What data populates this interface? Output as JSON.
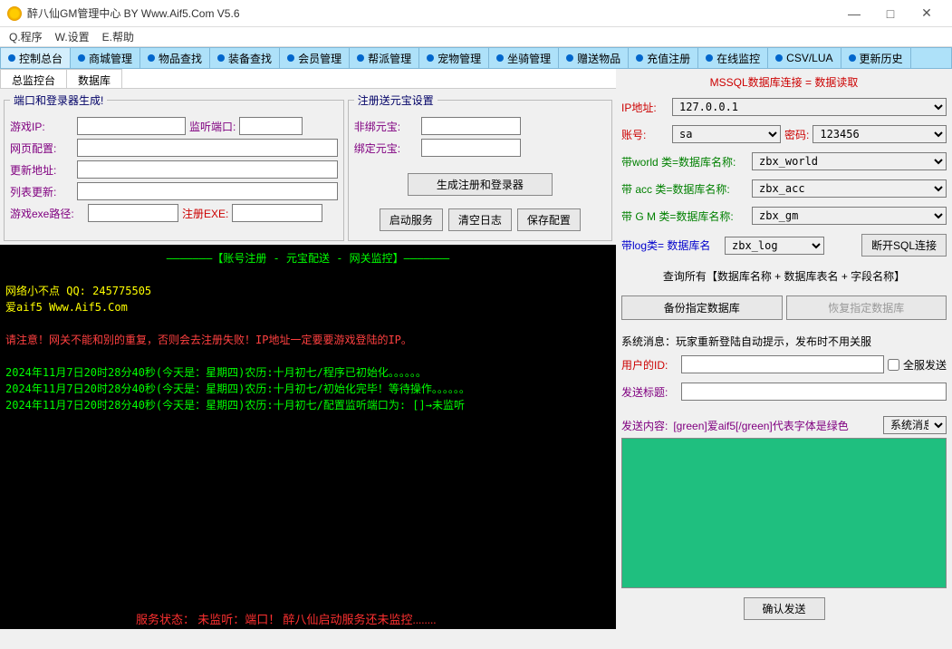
{
  "window": {
    "title": "醉八仙GM管理中心 BY Www.Aif5.Com  V5.6",
    "min": "—",
    "max": "□",
    "close": "✕"
  },
  "menu": {
    "program": "Q.程序",
    "settings": "W.设置",
    "help": "E.帮助"
  },
  "tabs": [
    "控制总台",
    "商城管理",
    "物品查找",
    "装备查找",
    "会员管理",
    "帮派管理",
    "宠物管理",
    "坐骑管理",
    "赠送物品",
    "充值注册",
    "在线监控",
    "CSV/LUA",
    "更新历史"
  ],
  "subtabs": [
    "总监控台",
    "数据库"
  ],
  "panel1": {
    "legend": "端口和登录器生成!",
    "game_ip": "游戏IP:",
    "listen_port": "监听端口:",
    "web_cfg": "网页配置:",
    "update_addr": "更新地址:",
    "list_update": "列表更新:",
    "exe_path": "游戏exe路径:",
    "reg_exe": "注册EXE:"
  },
  "panel2": {
    "legend": "注册送元宝设置",
    "unbind": "非绑元宝:",
    "bind": "绑定元宝:",
    "btn_gen": "生成注册和登录器",
    "btn_start": "启动服务",
    "btn_clear": "清空日志",
    "btn_save": "保存配置"
  },
  "console": {
    "header": "———————【账号注册 - 元宝配送 - 网关监控】———————",
    "line1": "网络小不点 QQ: 245775505",
    "line2": "爱aif5 Www.Aif5.Com",
    "warn": "请注意！网关不能和别的重复，否则会去注册失败！IP地址一定要要游戏登陆的IP。",
    "log1": "2024年11月7日20时28分40秒(今天是：星期四)农历:十月初七/程序已初始化。。。。。。",
    "log2": "2024年11月7日20时28分40秒(今天是：星期四)农历:十月初七/初始化完毕！等待操作。。。。。。",
    "log3": "2024年11月7日20时28分40秒(今天是：星期四)农历:十月初七/配置监听端口为: []→未监听"
  },
  "status": "服务状态：   未监听：端口！   醉八仙启动服务还未监控........",
  "db": {
    "header": "MSSQL数据库连接 = 数据读取",
    "ip_lbl": "IP地址:",
    "ip_val": "127.0.0.1",
    "acc_lbl": "账号:",
    "acc_val": "sa",
    "pwd_lbl": "密码:",
    "pwd_val": "123456",
    "world_lbl": "带world 类=数据库名称:",
    "world_val": "zbx_world",
    "acc2_lbl": "带 acc  类=数据库名称:",
    "acc2_val": "zbx_acc",
    "gm_lbl": "带 G M  类=数据库名称:",
    "gm_val": "zbx_gm",
    "log_lbl": "带log类= 数据库名",
    "log_val": "zbx_log",
    "disconnect": "断开SQL连接",
    "query_all": "查询所有【数据库名称 + 数据库表名 + 字段名称】",
    "backup": "备份指定数据库",
    "restore": "恢复指定数据库"
  },
  "sysmsg": {
    "header": "系统消息：玩家重新登陆自动提示，发布时不用关服",
    "user_id": "用户的ID:",
    "all_send": "全服发送",
    "title_lbl": "发送标题:",
    "content_lbl": "发送内容:",
    "content_hint": "[green]爱aif5[/green]代表字体是绿色",
    "type": "系统消息",
    "confirm": "确认发送"
  }
}
